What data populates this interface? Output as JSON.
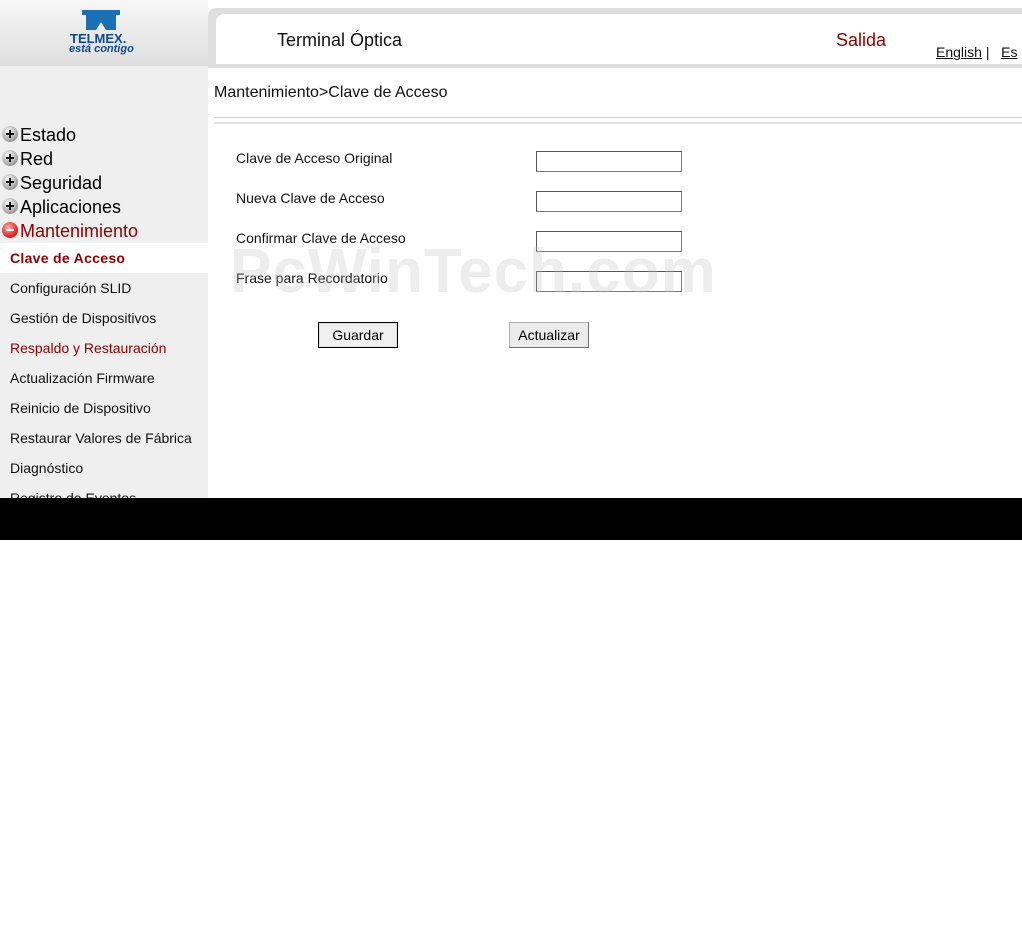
{
  "brand": {
    "wordmark": "TELMEX.",
    "tagline": "está contigo",
    "color": "#0d4a8c"
  },
  "header": {
    "title": "Terminal Óptica",
    "logout_label": "Salida",
    "lang_english": "English",
    "lang_separator": "|",
    "lang_spanish": "Es"
  },
  "sidebar": {
    "menu": [
      {
        "label": "Estado",
        "state": "collapsed",
        "icon": "plus-icon"
      },
      {
        "label": "Red",
        "state": "collapsed",
        "icon": "plus-icon"
      },
      {
        "label": "Seguridad",
        "state": "collapsed",
        "icon": "plus-icon"
      },
      {
        "label": "Aplicaciones",
        "state": "collapsed",
        "icon": "plus-icon"
      },
      {
        "label": "Mantenimiento",
        "state": "expanded",
        "icon": "minus-icon"
      }
    ],
    "submenu": [
      {
        "label": "Clave de Acceso",
        "current": true
      },
      {
        "label": "Configuración SLID"
      },
      {
        "label": "Gestión de Dispositivos"
      },
      {
        "label": "Respaldo y Restauración"
      },
      {
        "label": "Actualización Firmware"
      },
      {
        "label": "Reinicio de Dispositivo"
      },
      {
        "label": "Restaurar Valores de Fábrica"
      },
      {
        "label": "Diagnóstico"
      },
      {
        "label": "Registro de Eventos"
      }
    ]
  },
  "breadcrumb": "Mantenimiento>Clave de Acceso",
  "form": {
    "fields": [
      {
        "label": "Clave de Acceso Original",
        "value": ""
      },
      {
        "label": "Nueva Clave de Acceso",
        "value": ""
      },
      {
        "label": "Confirmar Clave de Acceso",
        "value": ""
      },
      {
        "label": "Frase para Recordatorio",
        "value": ""
      }
    ],
    "save_label": "Guardar",
    "refresh_label": "Actualizar"
  },
  "watermark": "PcWinTech.com",
  "colors": {
    "accent_red": "#8b0000",
    "sidebar_bg": "#efefef"
  }
}
